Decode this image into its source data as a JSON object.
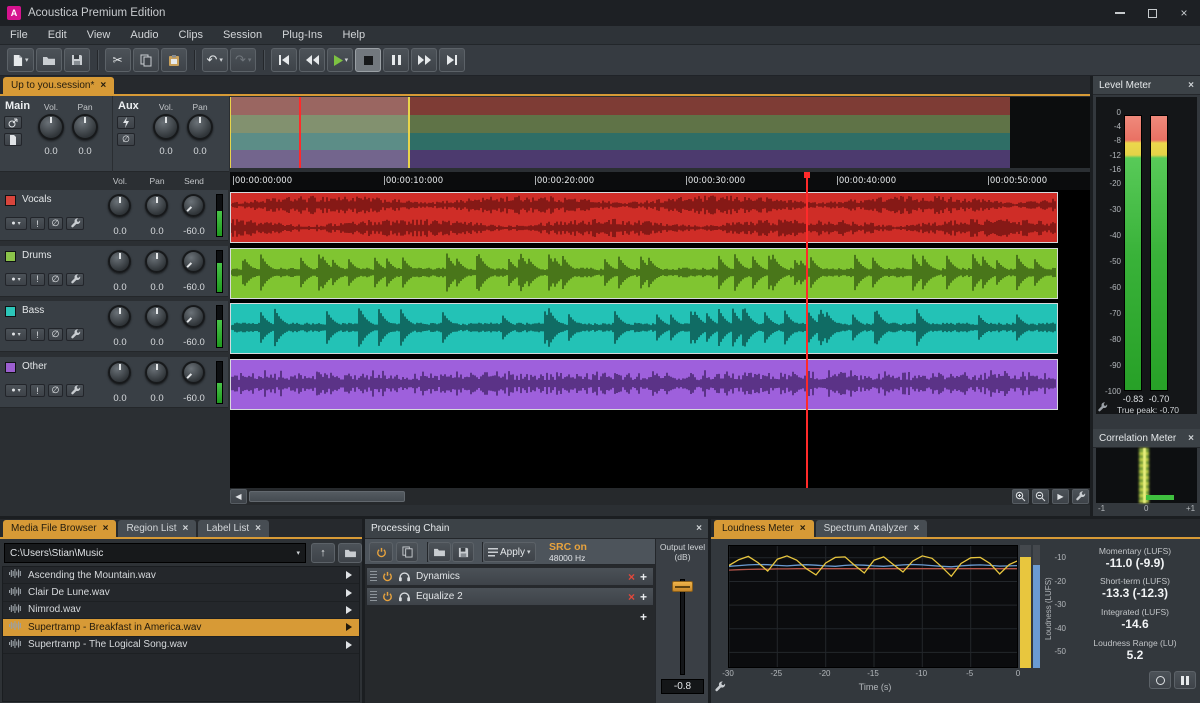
{
  "window": {
    "title": "Acoustica Premium Edition",
    "logo_letter": "A"
  },
  "accent_color": "#d79a36",
  "menubar": {
    "items": [
      "File",
      "Edit",
      "View",
      "Audio",
      "Clips",
      "Session",
      "Plug-Ins",
      "Help"
    ]
  },
  "toolbar": {
    "buttons": [
      "new",
      "open",
      "save",
      "cut",
      "copy",
      "paste",
      "undo",
      "redo",
      "skip-start",
      "rewind",
      "play",
      "stop",
      "pause",
      "fast-forward",
      "skip-end"
    ]
  },
  "session": {
    "tab": "Up to you.session*"
  },
  "mixer": {
    "main": {
      "label": "Main",
      "vol_label": "Vol.",
      "pan_label": "Pan",
      "vol": "0.0",
      "pan": "0.0"
    },
    "aux": {
      "label": "Aux",
      "vol_label": "Vol.",
      "pan_label": "Pan",
      "vol": "0.0",
      "pan": "0.0"
    }
  },
  "track_columns": {
    "vol": "Vol.",
    "pan": "Pan",
    "send": "Send"
  },
  "tracks": [
    {
      "name": "Vocals",
      "vol": "0.0",
      "pan": "0.0",
      "send": "-60.0",
      "color": "#d8453c",
      "lane": "#cf2d27",
      "wave": "#6e1311",
      "overview": "#7e3c35"
    },
    {
      "name": "Drums",
      "vol": "0.0",
      "pan": "0.0",
      "send": "-60.0",
      "color": "#8bc34a",
      "lane": "#80c531",
      "wave": "#375c12",
      "overview": "#5f7347"
    },
    {
      "name": "Bass",
      "vol": "0.0",
      "pan": "0.0",
      "send": "-60.0",
      "color": "#2cc6b9",
      "lane": "#23c2b6",
      "wave": "#0a4f49",
      "overview": "#2f6e66"
    },
    {
      "name": "Other",
      "vol": "0.0",
      "pan": "0.0",
      "send": "-60.0",
      "color": "#9c5fd0",
      "lane": "#9e60dc",
      "wave": "#45246b",
      "overview": "#4c3a6e"
    }
  ],
  "ruler": {
    "ticks": [
      "00:00:00:000",
      "00:00:10:000",
      "00:00:20:000",
      "00:00:30:000",
      "00:00:40:000",
      "00:00:50:000"
    ]
  },
  "level_meter": {
    "title": "Level Meter",
    "scale": [
      0,
      -4,
      -8,
      -12,
      -16,
      -20,
      -30,
      -40,
      -50,
      -60,
      -70,
      -80,
      -90,
      -100
    ],
    "peak_left": "-0.83",
    "peak_right": "-0.70",
    "true_peak": "True peak: -0.70"
  },
  "correlation_meter": {
    "title": "Correlation Meter",
    "scale": [
      "-1",
      "0",
      "+1"
    ]
  },
  "media_browser": {
    "tabs": [
      "Media File Browser",
      "Region List",
      "Label List"
    ],
    "path": "C:\\Users\\Stian\\Music",
    "files": [
      "Ascending the Mountain.wav",
      "Clair De Lune.wav",
      "Nimrod.wav",
      "Supertramp - Breakfast in America.wav",
      "Supertramp - The Logical Song.wav"
    ],
    "selected_index": 3
  },
  "processing_chain": {
    "title": "Processing Chain",
    "apply_label": "Apply",
    "src_line1": "SRC on",
    "src_line2": "48000 Hz",
    "output_label": "Output level (dB)",
    "output_value": "-0.8",
    "effects": [
      {
        "name": "Dynamics"
      },
      {
        "name": "Equalize 2"
      }
    ]
  },
  "loudness": {
    "tabs": [
      "Loudness Meter",
      "Spectrum Analyzer"
    ],
    "stats": [
      {
        "label": "Momentary (LUFS)",
        "value": "-11.0 (-9.9)"
      },
      {
        "label": "Short-term (LUFS)",
        "value": "-13.3 (-12.3)"
      },
      {
        "label": "Integrated (LUFS)",
        "value": "-14.6"
      },
      {
        "label": "Loudness Range (LU)",
        "value": "5.2"
      }
    ],
    "xlabel": "Time (s)",
    "ylabel": "Loudness (LUFS)",
    "x_ticks": [
      "-30",
      "-25",
      "-20",
      "-15",
      "-10",
      "-5",
      "0"
    ],
    "y_ticks": [
      "-10",
      "-20",
      "-30",
      "-40",
      "-50"
    ],
    "chart_data": {
      "type": "line",
      "x_range": [
        -30,
        0
      ],
      "y_range": [
        -5,
        -57
      ],
      "series": [
        {
          "name": "Momentary",
          "color": "#e8c63e",
          "values": [
            -13.2,
            -10.8,
            -9.4,
            -12.0,
            -15.6,
            -10.6,
            -9.2,
            -11.0,
            -14.6,
            -17.2,
            -12.2,
            -9.8,
            -9.6,
            -13.2,
            -16.4,
            -11.0,
            -9.6,
            -12.8,
            -16.0,
            -11.4,
            -9.2,
            -10.2,
            -13.8,
            -17.8,
            -12.4,
            -10.0,
            -9.8,
            -12.4,
            -16.8,
            -12.8,
            -11.0
          ]
        },
        {
          "name": "Short-term",
          "color": "#6b9bd2",
          "values": [
            -13.6,
            -13.3,
            -13.0,
            -12.8,
            -12.9,
            -13.2,
            -13.4,
            -13.1,
            -12.9,
            -13.1,
            -13.4,
            -13.6,
            -13.2,
            -13.0,
            -13.1,
            -13.4,
            -13.6,
            -13.3,
            -13.0,
            -12.8,
            -13.0,
            -13.3,
            -13.6,
            -13.8,
            -13.4,
            -13.1,
            -13.0,
            -13.2,
            -13.5,
            -13.4,
            -13.3
          ]
        },
        {
          "name": "Integrated",
          "color": "#b5554a",
          "values": [
            -15.2,
            -15.0,
            -14.9,
            -14.8,
            -14.8,
            -14.7,
            -14.7,
            -14.6,
            -14.6,
            -14.6,
            -14.6,
            -14.6,
            -14.6,
            -14.6,
            -14.6,
            -14.6,
            -14.6,
            -14.6,
            -14.6,
            -14.6,
            -14.6,
            -14.6,
            -14.6,
            -14.6,
            -14.6,
            -14.6,
            -14.6,
            -14.6,
            -14.6,
            -14.6,
            -14.6
          ]
        }
      ],
      "bars": [
        {
          "name": "momentary-bar",
          "color": "#e8c63e",
          "value": -10.2
        },
        {
          "name": "short-term-bar",
          "color": "#6b9bd2",
          "value": -13.3
        }
      ]
    }
  }
}
